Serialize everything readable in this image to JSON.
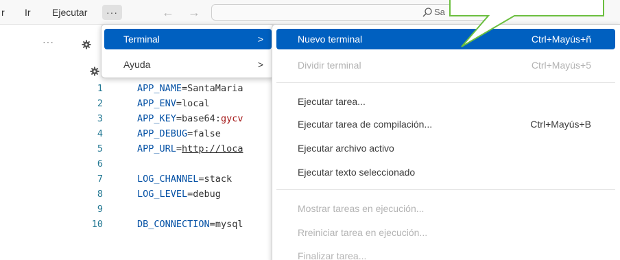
{
  "menubar": {
    "items": [
      {
        "label": "r"
      },
      {
        "label": "Ir"
      },
      {
        "label": "Ejecutar"
      },
      {
        "label": "···"
      }
    ],
    "back_arrow": "←",
    "forward_arrow": "→",
    "search_text": "Sa"
  },
  "editor": {
    "sidebar_more": "···",
    "lines": [
      {
        "n": "1",
        "key": "APP_NAME",
        "value": "SantaMaria"
      },
      {
        "n": "2",
        "key": "APP_ENV",
        "value": "local"
      },
      {
        "n": "3",
        "key": "APP_KEY",
        "value": "base64:",
        "value2": "gycv"
      },
      {
        "n": "4",
        "key": "APP_DEBUG",
        "value": "false"
      },
      {
        "n": "5",
        "key": "APP_URL",
        "value": "http://loca"
      },
      {
        "n": "6",
        "key": "",
        "value": ""
      },
      {
        "n": "7",
        "key": "LOG_CHANNEL",
        "value": "stack"
      },
      {
        "n": "8",
        "key": "LOG_LEVEL",
        "value": "debug"
      },
      {
        "n": "9",
        "key": "",
        "value": ""
      },
      {
        "n": "10",
        "key": "DB_CONNECTION",
        "value": "mysql"
      }
    ]
  },
  "menu_primary": {
    "items": [
      {
        "label": "Terminal",
        "chevron": ">"
      },
      {
        "label": "Ayuda",
        "chevron": ">"
      }
    ]
  },
  "menu_terminal": {
    "items": [
      {
        "label": "Nuevo terminal",
        "shortcut": "Ctrl+Mayús+ñ"
      },
      {
        "label": "Dividir terminal",
        "shortcut": "Ctrl+Mayús+5"
      },
      {
        "label": "Ejecutar tarea...",
        "shortcut": ""
      },
      {
        "label": "Ejecutar tarea de compilación...",
        "shortcut": "Ctrl+Mayús+B"
      },
      {
        "label": "Ejecutar archivo activo",
        "shortcut": ""
      },
      {
        "label": "Ejecutar texto seleccionado",
        "shortcut": ""
      },
      {
        "label": "Mostrar tareas en ejecución...",
        "shortcut": ""
      },
      {
        "label": "Rreiniciar tarea en ejecución...",
        "shortcut": ""
      },
      {
        "label": "Finalizar tarea...",
        "shortcut": ""
      }
    ]
  },
  "colors": {
    "highlight": "#0060c0",
    "callout_border": "#6bbf3f",
    "line_number": "#237893",
    "key": "#0451a5"
  },
  "icons": {
    "search": "search-icon",
    "gear": "gear-icon",
    "chevron": "chevron-right-icon"
  }
}
